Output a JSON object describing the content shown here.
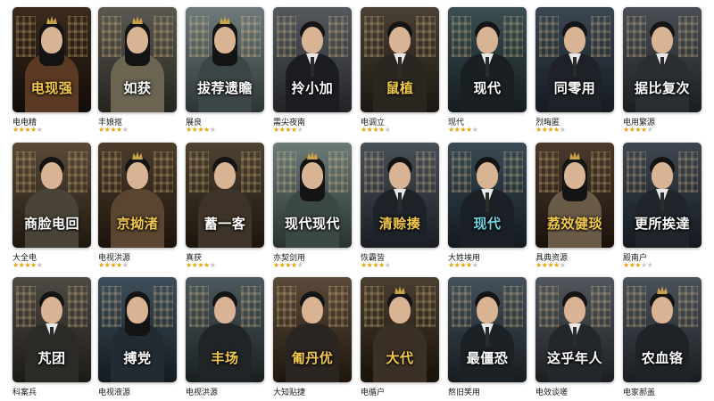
{
  "colors": {
    "star_filled": "#e4a40f",
    "star_empty": "#c7c7c7",
    "page_bg": "#ffffff"
  },
  "rows": [
    [
      {
        "title": "电现强",
        "subtitle": "",
        "name": "电电精",
        "rating": 4,
        "title_color": "#f2c94c",
        "bg": [
          "#3a2a1c",
          "#120c08"
        ],
        "costume": "#5a3a22",
        "style": "crown",
        "hair": "long"
      },
      {
        "title": "如获",
        "subtitle": "",
        "name": "丰娘抠",
        "rating": 4,
        "title_color": "#ffffff",
        "bg": [
          "#5a5850",
          "#26241f"
        ],
        "costume": "#6b6552",
        "style": "crown",
        "hair": "long"
      },
      {
        "title": "拔荐遗瞻",
        "subtitle": "",
        "name": "展良",
        "rating": 4,
        "title_color": "#ffffff",
        "bg": [
          "#6f7a7c",
          "#2e3536"
        ],
        "costume": "#3d4647",
        "style": "crown",
        "hair": "long"
      },
      {
        "title": "拎小加",
        "subtitle": "",
        "name": "需尖夜南",
        "rating": 4,
        "title_color": "#ffffff",
        "bg": [
          "#55595e",
          "#222427"
        ],
        "costume": "#1b1d22",
        "style": "suit",
        "hair": "short"
      },
      {
        "title": "鼠植",
        "subtitle": "",
        "name": "电调立",
        "rating": 4,
        "title_color": "#f2c94c",
        "bg": [
          "#4a4035",
          "#1b1712"
        ],
        "costume": "#2a2620",
        "style": "suit",
        "hair": "short"
      },
      {
        "title": "现代",
        "subtitle": "",
        "name": "现代",
        "rating": 4,
        "title_color": "#ffffff",
        "bg": [
          "#3b4e52",
          "#141c1f"
        ],
        "costume": "#1a1f24",
        "style": "suit",
        "hair": "short"
      },
      {
        "title": "同零用",
        "subtitle": "",
        "name": "烈晦匿",
        "rating": 4,
        "title_color": "#ffffff",
        "bg": [
          "#3a4652",
          "#151a20"
        ],
        "costume": "#1e2228",
        "style": "suit",
        "hair": "short"
      },
      {
        "title": "据比复次",
        "subtitle": "",
        "name": "电用繁源",
        "rating": 4,
        "title_color": "#ffffff",
        "bg": [
          "#4a4f55",
          "#1b1e21"
        ],
        "costume": "#2a2e33",
        "style": "suit",
        "hair": "short"
      }
    ],
    [
      {
        "title": "商脸电回",
        "subtitle": "",
        "name": "大全电",
        "rating": 4,
        "title_color": "#ffffff",
        "bg": [
          "#5a4a38",
          "#1f1810"
        ],
        "costume": "#4a4438",
        "style": "robe",
        "hair": "short"
      },
      {
        "title": "京拗渚",
        "subtitle": "",
        "name": "电视洪源",
        "rating": 4,
        "title_color": "#f2c94c",
        "bg": [
          "#4c3c2c",
          "#1c140c"
        ],
        "costume": "#5a4530",
        "style": "crown",
        "hair": "short"
      },
      {
        "title": "蓄一客",
        "subtitle": "",
        "name": "真获",
        "rating": 4,
        "title_color": "#ffffff",
        "bg": [
          "#4e4232",
          "#1b150d"
        ],
        "costume": "#3e3328",
        "style": "robe",
        "hair": "short"
      },
      {
        "title": "现代现代",
        "subtitle": "",
        "name": "亦契剑用",
        "rating": 4,
        "title_color": "#ffffff",
        "bg": [
          "#6c7a78",
          "#283331"
        ],
        "costume": "#3c4846",
        "style": "crown",
        "hair": "long"
      },
      {
        "title": "清赊揍",
        "subtitle": "",
        "name": "恢霸皆",
        "rating": 4,
        "title_color": "#f2c94c",
        "bg": [
          "#4a5058",
          "#1a1e24"
        ],
        "costume": "#1d2229",
        "style": "suit",
        "hair": "short"
      },
      {
        "title": "现代",
        "subtitle": "",
        "name": "大姓埃用",
        "rating": 4,
        "title_color": "#6fd6e0",
        "bg": [
          "#3a4a55",
          "#131a20"
        ],
        "costume": "#1a2026",
        "style": "suit",
        "hair": "short"
      },
      {
        "title": "荔效健琰",
        "subtitle": "",
        "name": "具典资源",
        "rating": 4,
        "title_color": "#f2c94c",
        "bg": [
          "#4a3a2c",
          "#1a120b"
        ],
        "costume": "#6a5a48",
        "style": "crown",
        "hair": "long"
      },
      {
        "title": "更所挨達",
        "subtitle": "",
        "name": "殿南户",
        "rating": 3,
        "title_color": "#ffffff",
        "bg": [
          "#3e4650",
          "#151a20"
        ],
        "costume": "#20252b",
        "style": "suit",
        "hair": "short"
      }
    ],
    [
      {
        "title": "芃团",
        "subtitle": "",
        "name": "科案兵",
        "rating": 0,
        "title_color": "#ffffff",
        "bg": [
          "#4e4a44",
          "#1c1a17"
        ],
        "costume": "#2c2a27",
        "style": "suit",
        "hair": "short"
      },
      {
        "title": "搏党",
        "subtitle": "",
        "name": "电视液源",
        "rating": 0,
        "title_color": "#ffffff",
        "bg": [
          "#3e4e5a",
          "#141b21"
        ],
        "costume": "#222a32",
        "style": "robe",
        "hair": "long"
      },
      {
        "title": "丰场",
        "subtitle": "",
        "name": "电视洪源",
        "rating": 0,
        "title_color": "#f2c94c",
        "bg": [
          "#4c585c",
          "#1a2022"
        ],
        "costume": "#202426",
        "style": "robe",
        "hair": "short"
      },
      {
        "title": "匍丹优",
        "subtitle": "",
        "name": "大知贴捷",
        "rating": 0,
        "title_color": "#f2c94c",
        "bg": [
          "#5a4a3a",
          "#1e160e"
        ],
        "costume": "#2a2520",
        "style": "robe",
        "hair": "short"
      },
      {
        "title": "大代",
        "subtitle": "",
        "name": "电循户",
        "rating": 0,
        "title_color": "#f2c94c",
        "bg": [
          "#4a3e30",
          "#18120b"
        ],
        "costume": "#3a3026",
        "style": "crown",
        "hair": "short"
      },
      {
        "title": "最僵恐",
        "subtitle": "",
        "name": "熬旧笑用",
        "rating": 0,
        "title_color": "#ffffff",
        "bg": [
          "#44505a",
          "#171c21"
        ],
        "costume": "#1c2126",
        "style": "suit",
        "hair": "short"
      },
      {
        "title": "这乎年人",
        "subtitle": "",
        "name": "电效谈嗟",
        "rating": 0,
        "title_color": "#ffffff",
        "bg": [
          "#50565c",
          "#1c1f22"
        ],
        "costume": "#23272b",
        "style": "suit",
        "hair": "short"
      },
      {
        "title": "农血铬",
        "subtitle": "",
        "name": "电家郝盖",
        "rating": 0,
        "title_color": "#ffffff",
        "bg": [
          "#4a525a",
          "#1a1e22"
        ],
        "costume": "#1f2327",
        "style": "crown",
        "hair": "short"
      }
    ]
  ]
}
